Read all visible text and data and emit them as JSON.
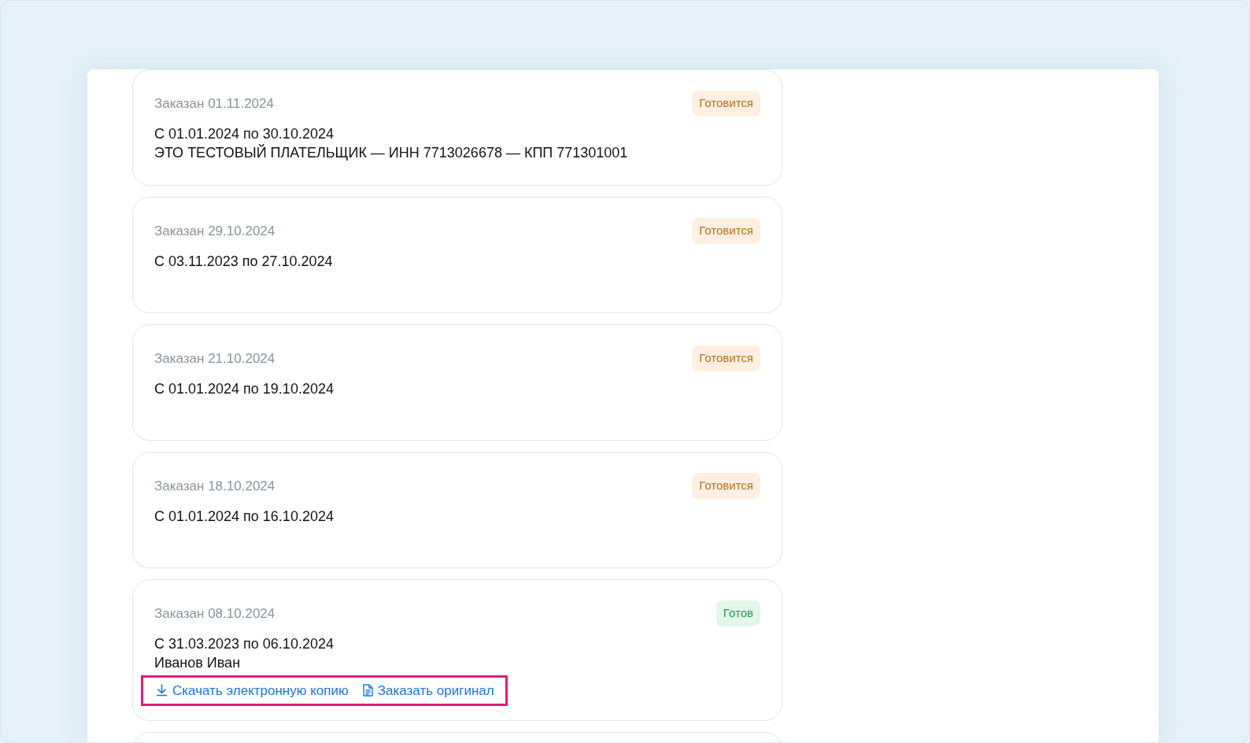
{
  "orders": [
    {
      "ordered": "Заказан 01.11.2024",
      "status": {
        "label": "Готовится",
        "kind": "preparing"
      },
      "lines": [
        "С 01.01.2024 по 30.10.2024",
        "ЭТО ТЕСТОВЫЙ ПЛАТЕЛЬЩИК — ИНН 7713026678 — КПП 771301001"
      ]
    },
    {
      "ordered": "Заказан 29.10.2024",
      "status": {
        "label": "Готовится",
        "kind": "preparing"
      },
      "lines": [
        "С 03.11.2023 по 27.10.2024"
      ]
    },
    {
      "ordered": "Заказан 21.10.2024",
      "status": {
        "label": "Готовится",
        "kind": "preparing"
      },
      "lines": [
        "С 01.01.2024 по 19.10.2024"
      ]
    },
    {
      "ordered": "Заказан 18.10.2024",
      "status": {
        "label": "Готовится",
        "kind": "preparing"
      },
      "lines": [
        "С 01.01.2024 по 16.10.2024"
      ]
    },
    {
      "ordered": "Заказан 08.10.2024",
      "status": {
        "label": "Готов",
        "kind": "ready"
      },
      "lines": [
        "С 31.03.2023 по 06.10.2024",
        "Иванов Иван"
      ],
      "actions": {
        "highlighted": true,
        "links": [
          {
            "label": "Скачать электронную копию",
            "kind": "download"
          },
          {
            "label": "Заказать оригинал",
            "kind": "document"
          }
        ]
      }
    }
  ]
}
